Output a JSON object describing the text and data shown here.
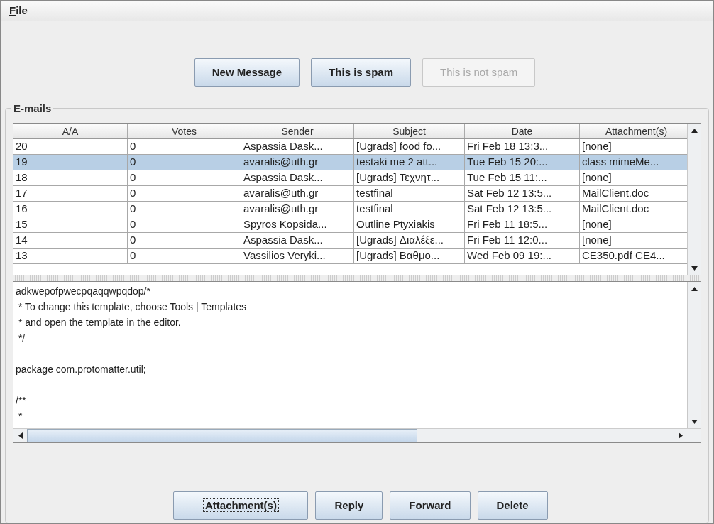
{
  "menu_bar": [
    {
      "label": "File"
    }
  ],
  "toolbar": [
    {
      "label": "New Message",
      "disabled": false
    },
    {
      "label": "This is spam",
      "disabled": false
    },
    {
      "label": "This is not spam",
      "disabled": true
    }
  ],
  "emails_panel": {
    "title": "E-mails",
    "table": {
      "columns": [
        "A/A",
        "Votes",
        "Sender",
        "Subject",
        "Date",
        "Attachment(s)"
      ],
      "rows": [
        {
          "cells": [
            "20",
            "0",
            "Aspassia Dask...",
            "[Ugrads] food fo...",
            "Fri Feb 18 13:3...",
            "[none]"
          ],
          "selected": false
        },
        {
          "cells": [
            "19",
            "0",
            "avaralis@uth.gr",
            "testaki me 2 att...",
            "Tue Feb 15 20:...",
            "class mimeMe..."
          ],
          "selected": true
        },
        {
          "cells": [
            "18",
            "0",
            "Aspassia Dask...",
            "[Ugrads] Τεχνητ...",
            "Tue Feb 15 11:...",
            "[none]"
          ],
          "selected": false
        },
        {
          "cells": [
            "17",
            "0",
            "avaralis@uth.gr",
            "testfinal",
            "Sat Feb 12 13:5...",
            "MailClient.doc"
          ],
          "selected": false
        },
        {
          "cells": [
            "16",
            "0",
            "avaralis@uth.gr",
            "testfinal",
            "Sat Feb 12 13:5...",
            "MailClient.doc"
          ],
          "selected": false
        },
        {
          "cells": [
            "15",
            "0",
            "Spyros Kopsida...",
            "Outline Ptyxiakis",
            "Fri Feb 11 18:5...",
            "[none]"
          ],
          "selected": false
        },
        {
          "cells": [
            "14",
            "0",
            "Aspassia Dask...",
            "[Ugrads] Διαλέξε...",
            "Fri Feb 11 12:0...",
            "[none]"
          ],
          "selected": false
        },
        {
          "cells": [
            "13",
            "0",
            "Vassilios Veryki...",
            "[Ugrads] Βαθμο...",
            "Wed Feb 09 19:...",
            "CE350.pdf CE4..."
          ],
          "selected": false
        }
      ]
    }
  },
  "message_body": {
    "text": "adkwepofpwecpqaqqwpqdop/*\n * To change this template, choose Tools | Templates\n * and open the template in the editor.\n */\n\npackage com.protomatter.util;\n\n/**\n *"
  },
  "bottom_buttons": [
    {
      "label": "Attachment(s)",
      "focused": true
    },
    {
      "label": "Reply",
      "focused": false
    },
    {
      "label": "Forward",
      "focused": false
    },
    {
      "label": "Delete",
      "focused": false
    }
  ]
}
